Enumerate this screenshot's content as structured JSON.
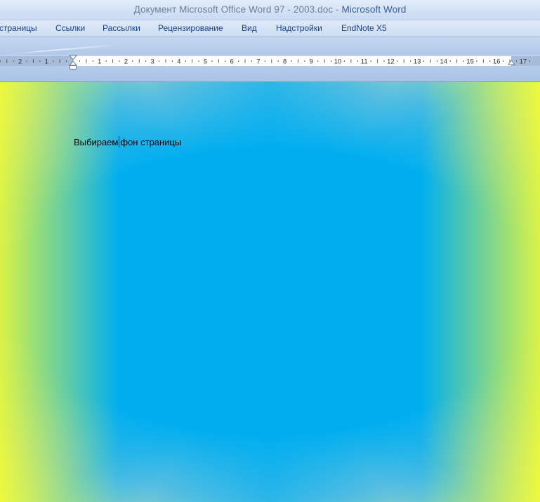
{
  "window": {
    "title_doc": "Документ Microsoft Office Word 97 - 2003.doc",
    "title_sep": " - ",
    "title_app": "Microsoft Word"
  },
  "ribbon": {
    "tabs": [
      {
        "label": "страницы"
      },
      {
        "label": "Ссылки"
      },
      {
        "label": "Рассылки"
      },
      {
        "label": "Рецензирование"
      },
      {
        "label": "Вид"
      },
      {
        "label": "Надстройки"
      },
      {
        "label": "EndNote X5"
      }
    ]
  },
  "ruler": {
    "left_numbers": [
      "2",
      "1"
    ],
    "numbers": [
      "1",
      "2",
      "3",
      "4",
      "5",
      "6",
      "7",
      "8",
      "9",
      "10",
      "11",
      "12",
      "13",
      "14",
      "15",
      "16",
      "17"
    ]
  },
  "document": {
    "text_before_caret": "Выбираем",
    "text_after_caret": "фон страницы",
    "background_colors": {
      "edge": "#ffff1f",
      "center": "#00aef0"
    }
  }
}
